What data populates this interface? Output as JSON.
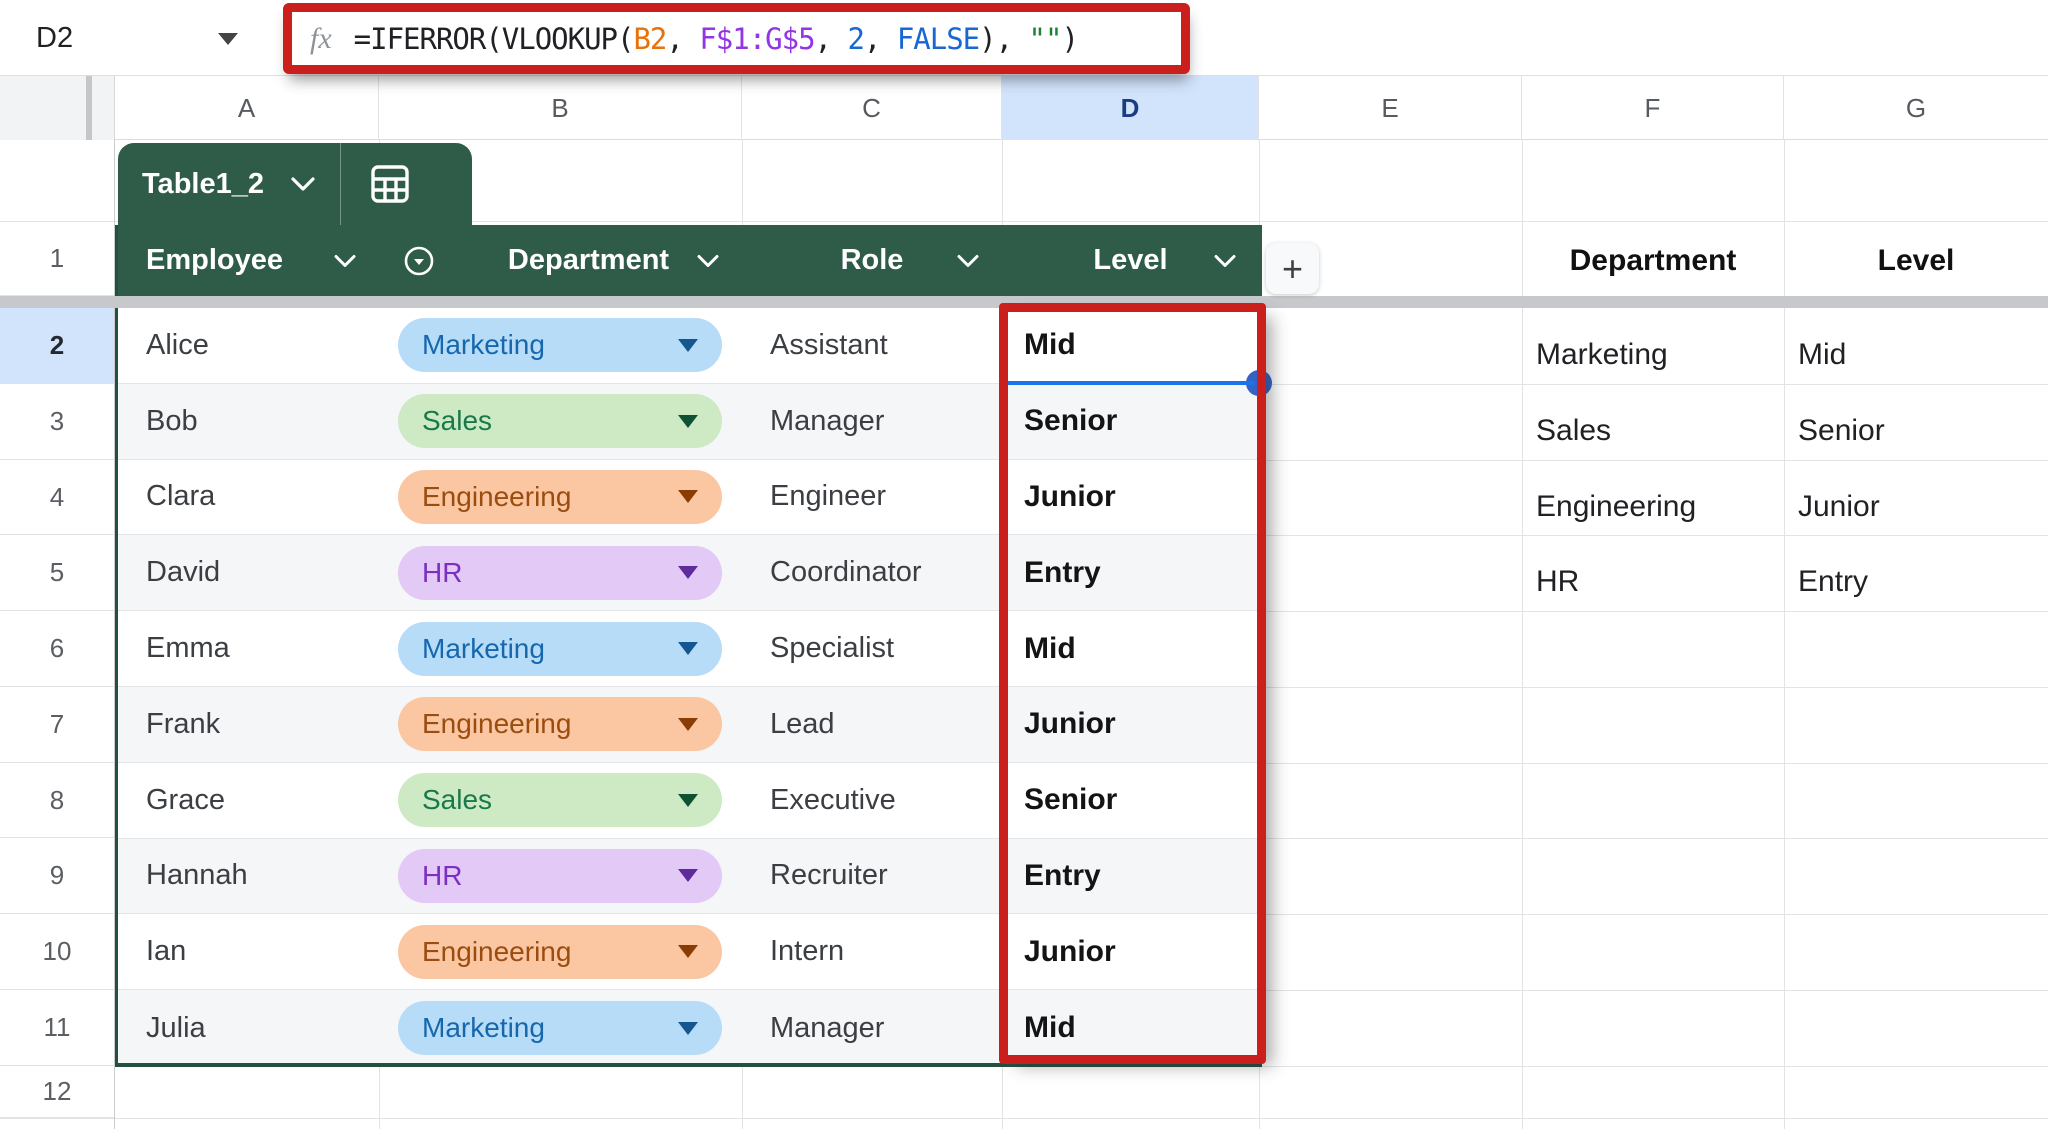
{
  "formula_bar": {
    "cell_reference": "D2",
    "fx_label": "fx",
    "formula_tokens": [
      {
        "text": "=IFERROR(VLOOKUP(",
        "color": "#202124"
      },
      {
        "text": "B2",
        "color": "#e8710a"
      },
      {
        "text": ", ",
        "color": "#202124"
      },
      {
        "text": "F$1:G$5",
        "color": "#9334e6"
      },
      {
        "text": ", ",
        "color": "#202124"
      },
      {
        "text": "2",
        "color": "#1967d2"
      },
      {
        "text": ", ",
        "color": "#202124"
      },
      {
        "text": "FALSE",
        "color": "#1967d2"
      },
      {
        "text": "), ",
        "color": "#202124"
      },
      {
        "text": "\"\"",
        "color": "#188038"
      },
      {
        "text": ")",
        "color": "#202124"
      }
    ]
  },
  "column_headers": [
    "A",
    "B",
    "C",
    "D",
    "E",
    "F",
    "G"
  ],
  "selected_column": "D",
  "row_numbers": [
    "1",
    "2",
    "3",
    "4",
    "5",
    "6",
    "7",
    "8",
    "9",
    "10",
    "11",
    "12"
  ],
  "selected_row": "2",
  "table": {
    "name": "Table1_2",
    "columns": [
      "Employee",
      "Department",
      "Role",
      "Level"
    ],
    "rows": [
      {
        "employee": "Alice",
        "department": "Marketing",
        "role": "Assistant",
        "level": "Mid"
      },
      {
        "employee": "Bob",
        "department": "Sales",
        "role": "Manager",
        "level": "Senior"
      },
      {
        "employee": "Clara",
        "department": "Engineering",
        "role": "Engineer",
        "level": "Junior"
      },
      {
        "employee": "David",
        "department": "HR",
        "role": "Coordinator",
        "level": "Entry"
      },
      {
        "employee": "Emma",
        "department": "Marketing",
        "role": "Specialist",
        "level": "Mid"
      },
      {
        "employee": "Frank",
        "department": "Engineering",
        "role": "Lead",
        "level": "Junior"
      },
      {
        "employee": "Grace",
        "department": "Sales",
        "role": "Executive",
        "level": "Senior"
      },
      {
        "employee": "Hannah",
        "department": "HR",
        "role": "Recruiter",
        "level": "Entry"
      },
      {
        "employee": "Ian",
        "department": "Engineering",
        "role": "Intern",
        "level": "Junior"
      },
      {
        "employee": "Julia",
        "department": "Marketing",
        "role": "Manager",
        "level": "Mid"
      }
    ]
  },
  "departments": {
    "Marketing": {
      "bg": "#b7dcf8",
      "fg": "#1667ad",
      "arrow": "#14568f"
    },
    "Sales": {
      "bg": "#cdeac5",
      "fg": "#19794a",
      "arrow": "#0f5132"
    },
    "Engineering": {
      "bg": "#fbc6a2",
      "fg": "#9a4d0f",
      "arrow": "#8a3c05"
    },
    "HR": {
      "bg": "#e3c9f6",
      "fg": "#7c2fc0",
      "arrow": "#5e2b9e"
    }
  },
  "lookup_table": {
    "headers": [
      "Department",
      "Level"
    ],
    "rows": [
      [
        "Marketing",
        "Mid"
      ],
      [
        "Sales",
        "Senior"
      ],
      [
        "Engineering",
        "Junior"
      ],
      [
        "HR",
        "Entry"
      ]
    ]
  },
  "add_column_label": "+",
  "colors": {
    "table_header_green": "#2e5c49",
    "annotation_red": "#cb1f1d",
    "selection_blue": "#1a73e8",
    "selected_header_blue": "#d2e3fc",
    "banded_row_gray": "#f5f6f8"
  }
}
